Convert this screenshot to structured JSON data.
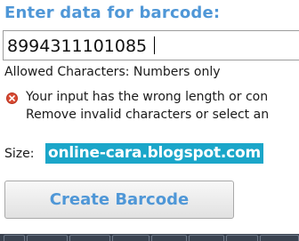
{
  "heading": "Enter data for barcode:",
  "input": {
    "value": "8994311101085"
  },
  "allowed_text": "Allowed Characters: Numbers only",
  "error": {
    "icon": "error-x-icon",
    "color": "#d84a33",
    "line1": "Your input has the wrong length or con",
    "line2": "Remove invalid characters or select an"
  },
  "size_label": "Size:",
  "watermark": "online-cara.blogspot.com",
  "create_button_label": "Create Barcode",
  "colors": {
    "accent": "#4f97d7",
    "watermark_bg": "#1ba6c9",
    "taskbar": "#3a4350"
  }
}
